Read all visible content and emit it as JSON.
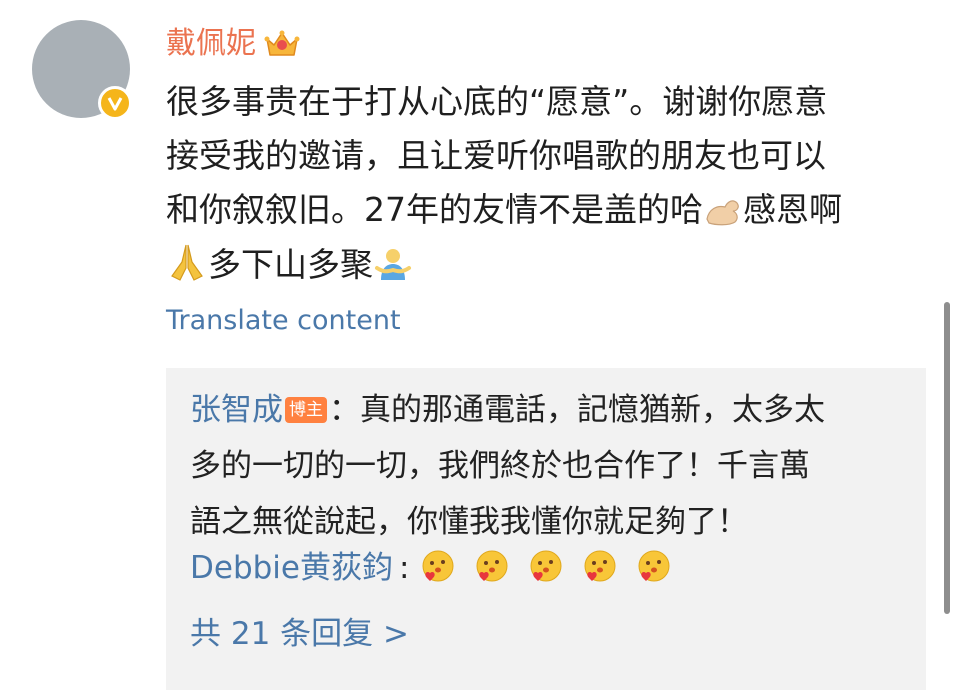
{
  "post": {
    "username": "戴佩妮",
    "lines": [
      "很多事贵在于打从心底的“愿意”。谢谢你愿意",
      "接受我的邀请，且让爱听你唱歌的朋友也可以",
      "和你叙叙旧。27年的友情不是盖的哈",
      "感恩啊",
      "多下山多聚"
    ],
    "translate_label": "Translate content"
  },
  "replies": {
    "first": {
      "author": "张智成",
      "badge": "博主",
      "separator": "：",
      "lines": [
        "真的那通電話，記憶猶新，太多太",
        "多的一切的一切，我們終於也合作了！千言萬",
        "語之無從說起，你懂我我懂你就足夠了！"
      ]
    },
    "second": {
      "author": "Debbie黄荻鈞",
      "separator": ":"
    },
    "more_label": "共 21 条回复 >"
  },
  "icons": {
    "avatar": "avatar-placeholder",
    "verified": "verified-badge-icon",
    "crown": "crown-icon",
    "emoji_hand": "flexed-hand-emoji",
    "emoji_pray": "praying-hands-emoji",
    "emoji_hug": "hugging-person-emoji",
    "emoji_love": "heart-face-emoji"
  },
  "colors": {
    "username": "#eb7350",
    "link": "#4a78a9",
    "badge": "#ff8140",
    "verified": "#f5b51b",
    "reply_bg": "#f2f2f2"
  }
}
